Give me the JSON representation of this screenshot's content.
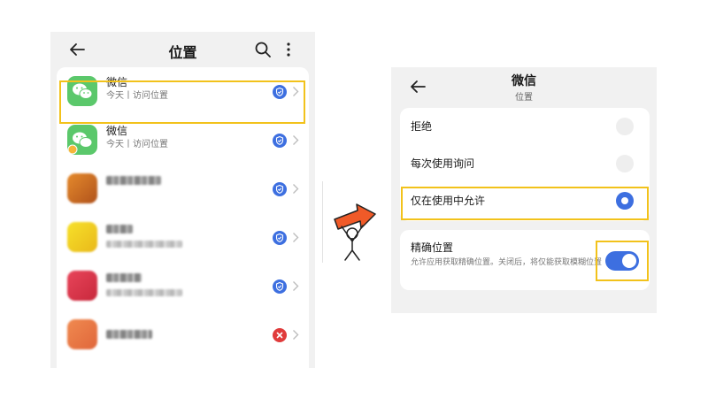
{
  "left_screen": {
    "title": "位置",
    "icons": {
      "back": "back-arrow-icon",
      "search": "search-icon",
      "more": "more-vertical-icon"
    },
    "apps": [
      {
        "name": "微信",
        "subtitle": "今天丨访问位置",
        "icon": "wechat-icon",
        "status": "allowed-shield",
        "highlighted": true
      },
      {
        "name": "微信",
        "subtitle": "今天丨访问位置",
        "icon": "wechat-clone-icon",
        "status": "allowed-shield",
        "highlighted": false
      },
      {
        "name": "",
        "subtitle": "",
        "icon": "blurred-app-icon-orange",
        "status": "allowed-shield"
      },
      {
        "name": "",
        "subtitle": "",
        "icon": "blurred-app-icon-yellow",
        "status": "allowed-shield"
      },
      {
        "name": "",
        "subtitle": "",
        "icon": "blurred-app-icon-red",
        "status": "allowed-shield"
      },
      {
        "name": "",
        "subtitle": "",
        "icon": "blurred-app-icon-orange",
        "status": "denied-x"
      }
    ]
  },
  "right_screen": {
    "title": "微信",
    "subtitle": "位置",
    "options": [
      {
        "label": "拒绝",
        "selected": false
      },
      {
        "label": "每次使用询问",
        "selected": false
      },
      {
        "label": "仅在使用中允许",
        "selected": true
      }
    ],
    "precise": {
      "label": "精确位置",
      "description": "允许应用获取精确位置。关闭后，将仅能获取模糊位置",
      "enabled": true
    }
  },
  "colors": {
    "highlight": "#f2c21b",
    "accent": "#3d6fe0",
    "wechat_green": "#5bc86b",
    "denied_red": "#e03b3b",
    "mascot_arrow": "#f05a28"
  }
}
